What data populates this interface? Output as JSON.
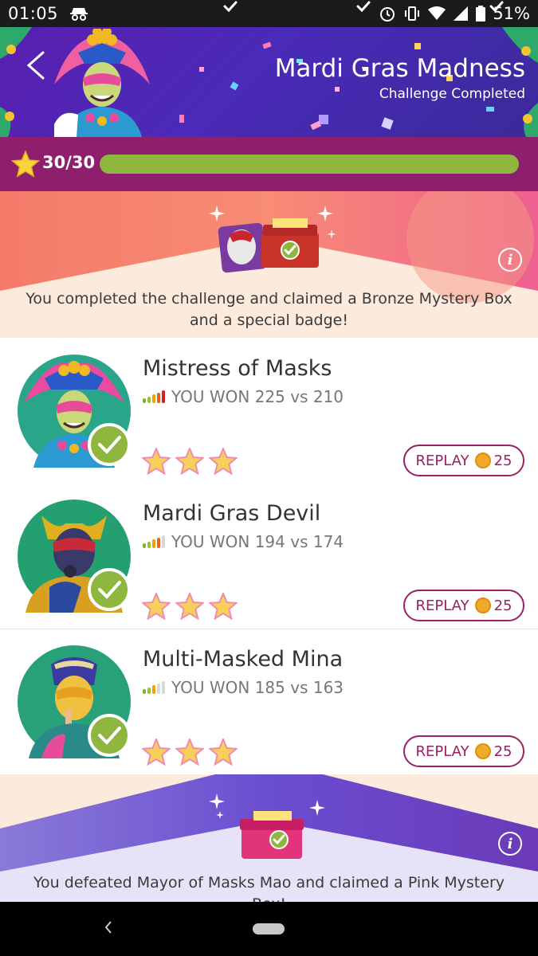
{
  "status_bar": {
    "time": "01:05",
    "battery": "51%"
  },
  "header": {
    "title": "Mardi Gras Madness",
    "subtitle": "Challenge Completed"
  },
  "progress": {
    "label": "30/30",
    "fraction": 1.0,
    "milestones": 3
  },
  "reward_top": {
    "text": "You completed the challenge and claimed a Bronze Mystery Box and a special badge!"
  },
  "opponents": [
    {
      "name": "Mistress of Masks",
      "result": "YOU WON 225 vs 210",
      "difficulty_bars": 5,
      "difficulty_level": 5,
      "stars": 3,
      "replay_label": "REPLAY",
      "replay_cost": "25",
      "avatar_bg": "#2aa58a"
    },
    {
      "name": "Mardi Gras Devil",
      "result": "YOU WON 194 vs 174",
      "difficulty_bars": 5,
      "difficulty_level": 4,
      "stars": 3,
      "replay_label": "REPLAY",
      "replay_cost": "25",
      "avatar_bg": "#24a070"
    },
    {
      "name": "Multi-Masked Mina",
      "result": "YOU WON 185 vs 163",
      "difficulty_bars": 5,
      "difficulty_level": 3,
      "stars": 3,
      "replay_label": "REPLAY",
      "replay_cost": "25",
      "avatar_bg": "#28a07a"
    }
  ],
  "reward_bottom": {
    "text": "You defeated Mayor of Masks Mao and claimed a Pink Mystery Box!"
  },
  "colors": {
    "accent": "#9b2163",
    "progress_bg": "#8d1f6c",
    "progress_fill": "#8fb740",
    "check_green": "#8fb740"
  }
}
